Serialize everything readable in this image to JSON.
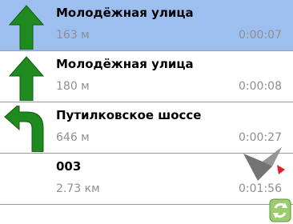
{
  "route": {
    "steps": [
      {
        "street": "Молодёжная улица",
        "distance": "163 м",
        "time": "0:00:07",
        "turn_icon": "straight-arrow-icon"
      },
      {
        "street": "Молодёжная улица",
        "distance": "180 м",
        "time": "0:00:08",
        "turn_icon": "straight-arrow-icon"
      },
      {
        "street": "Путилковское шоссе",
        "distance": "646 м",
        "time": "0:00:27",
        "turn_icon": "turn-left-arrow-icon"
      },
      {
        "street": "003",
        "distance": "2.73 км",
        "time": "0:01:56",
        "turn_icon": "none"
      }
    ],
    "selected_index": 0
  },
  "colors": {
    "selected_row": "#9dbff0",
    "arrow_green": "#1f8a1f",
    "secondary_text": "#8f8f8f"
  }
}
